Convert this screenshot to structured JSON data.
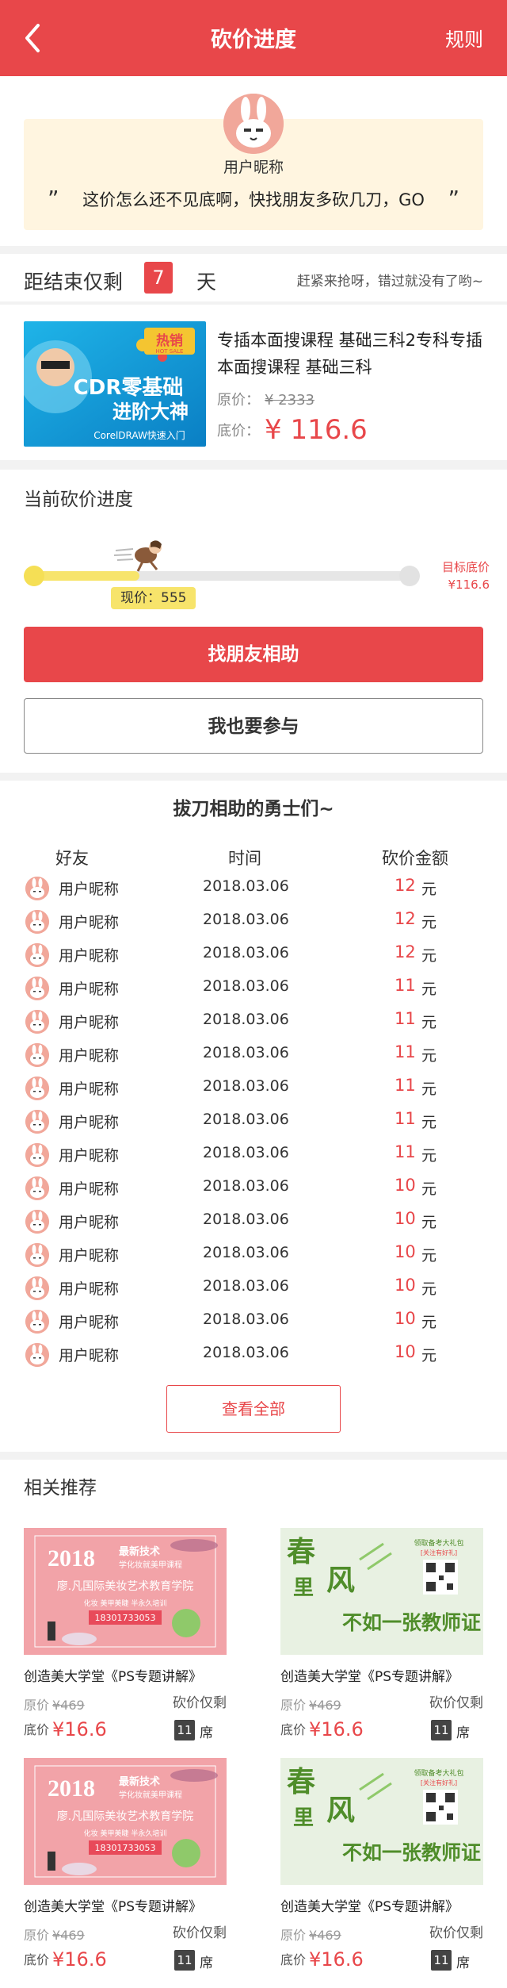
{
  "header": {
    "title": "砍价进度",
    "rules_label": "规则"
  },
  "user": {
    "nickname": "用户昵称",
    "quote": "这价怎么还不见底啊，快找朋友多砍几刀，GO",
    "quote_open": "”",
    "quote_close": "”"
  },
  "countdown": {
    "label": "距结束仅剩",
    "days": "7",
    "unit": "天",
    "tip": "赶紧来抢呀，错过就没有了哟~"
  },
  "product": {
    "title": "专插本面搜课程 基础三科2专科专插本面搜课程  基础三科",
    "orig_label": "原价：",
    "orig_value": "¥ 2333",
    "floor_label": "底价：",
    "floor_value": "¥ 116.6",
    "image": {
      "badge": "热销",
      "badge_sub": "HOT SALE",
      "line1": "CDR零基础",
      "line2": "进阶大神",
      "line3": "CorelDRAW快速入门"
    }
  },
  "progress": {
    "title": "当前砍价进度",
    "current_label": "现价：555",
    "target_label": "目标底价",
    "target_value": "¥116.6",
    "fill_fraction": 0.28
  },
  "buttons": {
    "help": "找朋友相助",
    "join": "我也要参与",
    "view_all": "查看全部"
  },
  "helpers": {
    "title": "拔刀相助的勇士们~",
    "columns": [
      "好友",
      "时间",
      "砍价金额"
    ],
    "unit": "元",
    "rows": [
      {
        "name": "用户昵称",
        "date": "2018.03.06",
        "amount": "12"
      },
      {
        "name": "用户昵称",
        "date": "2018.03.06",
        "amount": "12"
      },
      {
        "name": "用户昵称",
        "date": "2018.03.06",
        "amount": "12"
      },
      {
        "name": "用户昵称",
        "date": "2018.03.06",
        "amount": "11"
      },
      {
        "name": "用户昵称",
        "date": "2018.03.06",
        "amount": "11"
      },
      {
        "name": "用户昵称",
        "date": "2018.03.06",
        "amount": "11"
      },
      {
        "name": "用户昵称",
        "date": "2018.03.06",
        "amount": "11"
      },
      {
        "name": "用户昵称",
        "date": "2018.03.06",
        "amount": "11"
      },
      {
        "name": "用户昵称",
        "date": "2018.03.06",
        "amount": "11"
      },
      {
        "name": "用户昵称",
        "date": "2018.03.06",
        "amount": "10"
      },
      {
        "name": "用户昵称",
        "date": "2018.03.06",
        "amount": "10"
      },
      {
        "name": "用户昵称",
        "date": "2018.03.06",
        "amount": "10"
      },
      {
        "name": "用户昵称",
        "date": "2018.03.06",
        "amount": "10"
      },
      {
        "name": "用户昵称",
        "date": "2018.03.06",
        "amount": "10"
      },
      {
        "name": "用户昵称",
        "date": "2018.03.06",
        "amount": "10"
      }
    ]
  },
  "recommend": {
    "title": "相关推荐",
    "banner_pink": {
      "year": "2018",
      "headline": "最新技术",
      "sub": "学化妆就美甲课程",
      "school": "廖.凡国际美妆艺术教育学院",
      "tags": "化妆 美甲美睫 半永久培训",
      "phone": "18301733053"
    },
    "banner_green": {
      "c1": "春",
      "c2": "风",
      "c3": "里",
      "slogan": "不如一张教师证",
      "gift": "领取备考大礼包",
      "follow": "[关注有好礼]"
    },
    "cards": [
      {
        "name": "创造美大学堂《PS专题讲解》",
        "orig_label": "原价",
        "orig_value": "¥469",
        "floor_label": "底价",
        "floor_value": "¥16.6",
        "remain_label": "砍价仅剩",
        "seats": "11",
        "seat_unit": "席",
        "image": "pink"
      },
      {
        "name": "创造美大学堂《PS专题讲解》",
        "orig_label": "原价",
        "orig_value": "¥469",
        "floor_label": "底价",
        "floor_value": "¥16.6",
        "remain_label": "砍价仅剩",
        "seats": "11",
        "seat_unit": "席",
        "image": "green"
      },
      {
        "name": "创造美大学堂《PS专题讲解》",
        "orig_label": "原价",
        "orig_value": "¥469",
        "floor_label": "底价",
        "floor_value": "¥16.6",
        "remain_label": "砍价仅剩",
        "seats": "11",
        "seat_unit": "席",
        "image": "pink"
      },
      {
        "name": "创造美大学堂《PS专题讲解》",
        "orig_label": "原价",
        "orig_value": "¥469",
        "floor_label": "底价",
        "floor_value": "¥16.6",
        "remain_label": "砍价仅剩",
        "seats": "11",
        "seat_unit": "席",
        "image": "green"
      }
    ]
  },
  "colors": {
    "brand": "#e8474a",
    "progress": "#f7e46b",
    "quote_bg": "#fff5e0"
  }
}
